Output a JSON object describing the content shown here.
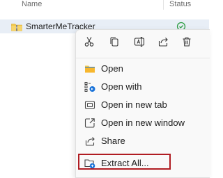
{
  "list_header": {
    "name_label": "Name",
    "status_label": "Status"
  },
  "file_row": {
    "name": "SmarterMeTracker",
    "icon": "zip-folder-icon",
    "status_icon": "synced-icon"
  },
  "context_menu": {
    "toolbar": [
      {
        "icon": "cut-icon"
      },
      {
        "icon": "copy-icon"
      },
      {
        "icon": "rename-icon"
      },
      {
        "icon": "share-icon"
      },
      {
        "icon": "delete-icon"
      }
    ],
    "items": [
      {
        "label": "Open",
        "icon": "folder-icon"
      },
      {
        "label": "Open with",
        "icon": "open-with-icon"
      },
      {
        "label": "Open in new tab",
        "icon": "new-tab-icon"
      },
      {
        "label": "Open in new window",
        "icon": "new-window-icon"
      },
      {
        "label": "Share",
        "icon": "share-icon"
      },
      {
        "label": "Extract All...",
        "icon": "extract-icon"
      }
    ]
  },
  "colors": {
    "accent": "#005fb8",
    "highlight_border": "#b01c22",
    "folder_yellow": "#f2c94c",
    "selected_row": "#e8eef6"
  }
}
